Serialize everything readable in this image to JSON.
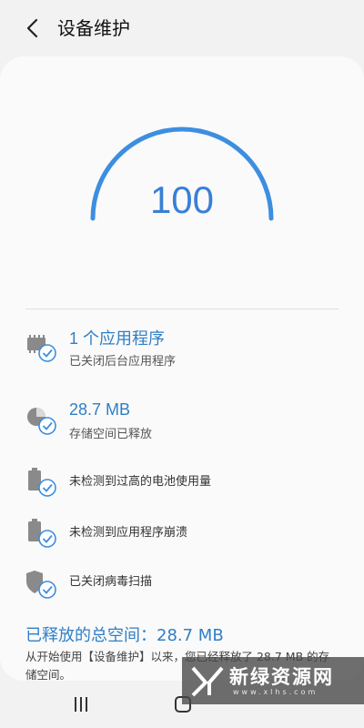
{
  "header": {
    "title": "设备维护",
    "back_icon": "chevron-left-icon"
  },
  "gauge": {
    "score": "100",
    "level": 1.0,
    "color": "#3d8ee0"
  },
  "items": [
    {
      "icon": "memory-check-icon",
      "primary": "1 个应用程序",
      "secondary": "已关闭后台应用程序"
    },
    {
      "icon": "storage-check-icon",
      "primary": "28.7 MB",
      "secondary": "存储空间已释放"
    },
    {
      "icon": "battery-check-icon",
      "text": "未检测到过高的电池使用量"
    },
    {
      "icon": "battery-check-icon",
      "text": "未检测到应用程序崩溃"
    },
    {
      "icon": "shield-check-icon",
      "text": "已关闭病毒扫描"
    }
  ],
  "summary": {
    "title": "已释放的总空间：28.7 MB",
    "description": "从开始使用【设备维护】以来，您已经释放了 28.7 MB 的存储空间。"
  },
  "watermark": {
    "text": "新绿资源网",
    "url": "www.xlhs.com"
  },
  "colors": {
    "accent": "#2f7fc6",
    "check": "#3d8ee0",
    "icon_gray": "#8a8a8a"
  }
}
